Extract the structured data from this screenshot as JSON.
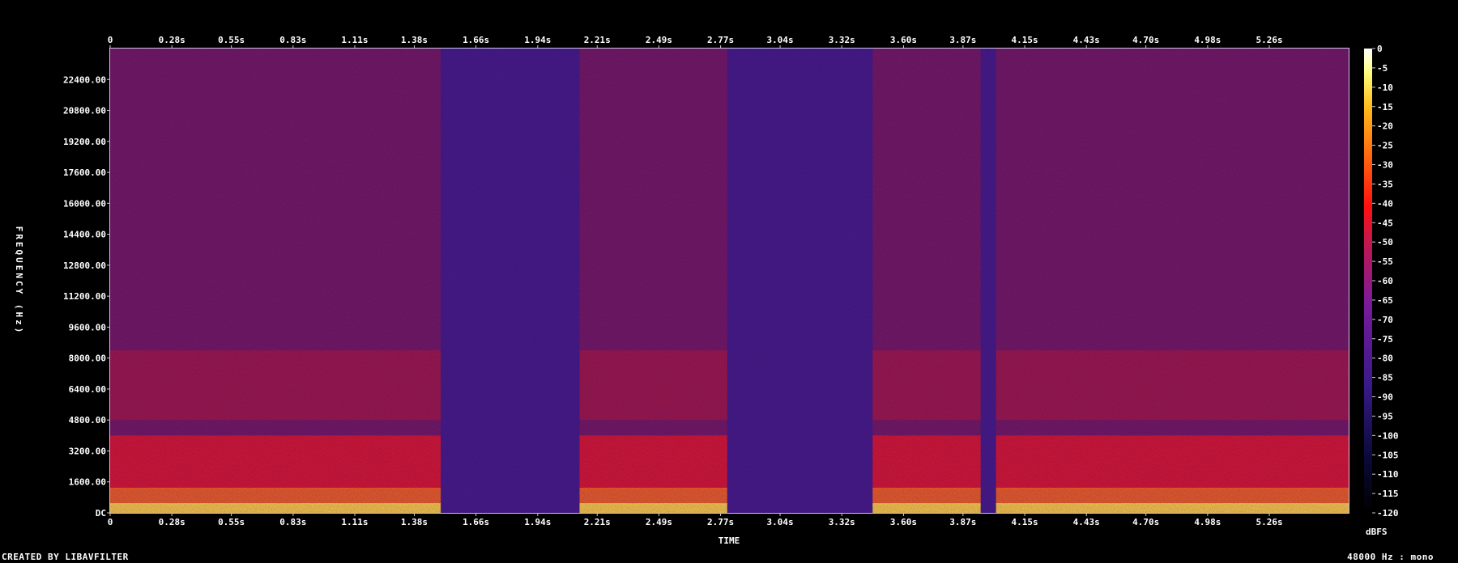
{
  "chart_data": {
    "type": "heatmap",
    "title": "",
    "xlabel": "TIME",
    "ylabel": "FREQUENCY (Hz)",
    "x_ticks": [
      "0",
      "0.28s",
      "0.55s",
      "0.83s",
      "1.11s",
      "1.38s",
      "1.66s",
      "1.94s",
      "2.21s",
      "2.49s",
      "2.77s",
      "3.04s",
      "3.32s",
      "3.60s",
      "3.87s",
      "4.15s",
      "4.43s",
      "4.70s",
      "4.98s",
      "5.26s"
    ],
    "x_tick_values": [
      0,
      0.28,
      0.55,
      0.83,
      1.11,
      1.38,
      1.66,
      1.94,
      2.21,
      2.49,
      2.77,
      3.04,
      3.32,
      3.6,
      3.87,
      4.15,
      4.43,
      4.7,
      4.98,
      5.26
    ],
    "xlim": [
      0,
      5.62
    ],
    "y_ticks": [
      "DC",
      "1600.00",
      "3200.00",
      "4800.00",
      "6400.00",
      "8000.00",
      "9600.00",
      "11200.00",
      "12800.00",
      "14400.00",
      "16000.00",
      "17600.00",
      "19200.00",
      "20800.00",
      "22400.00"
    ],
    "y_tick_values": [
      0,
      1600,
      3200,
      4800,
      6400,
      8000,
      9600,
      11200,
      12800,
      14400,
      16000,
      17600,
      19200,
      20800,
      22400
    ],
    "ylim": [
      0,
      24000
    ],
    "colorbar": {
      "label": "dBFS",
      "ticks": [
        "0",
        "-5",
        "-10",
        "-15",
        "-20",
        "-25",
        "-30",
        "-35",
        "-40",
        "-45",
        "-50",
        "-55",
        "-60",
        "-65",
        "-70",
        "-75",
        "-80",
        "-85",
        "-90",
        "-95",
        "-100",
        "-105",
        "-110",
        "-115",
        "-120"
      ],
      "range": [
        -120,
        0
      ]
    },
    "speech_segments_s": [
      [
        0.0,
        1.5
      ],
      [
        2.13,
        2.8
      ],
      [
        3.46,
        3.95
      ],
      [
        4.02,
        5.62
      ]
    ]
  },
  "footer": {
    "left": "CREATED BY LIBAVFILTER",
    "right": "48000 Hz : mono"
  }
}
